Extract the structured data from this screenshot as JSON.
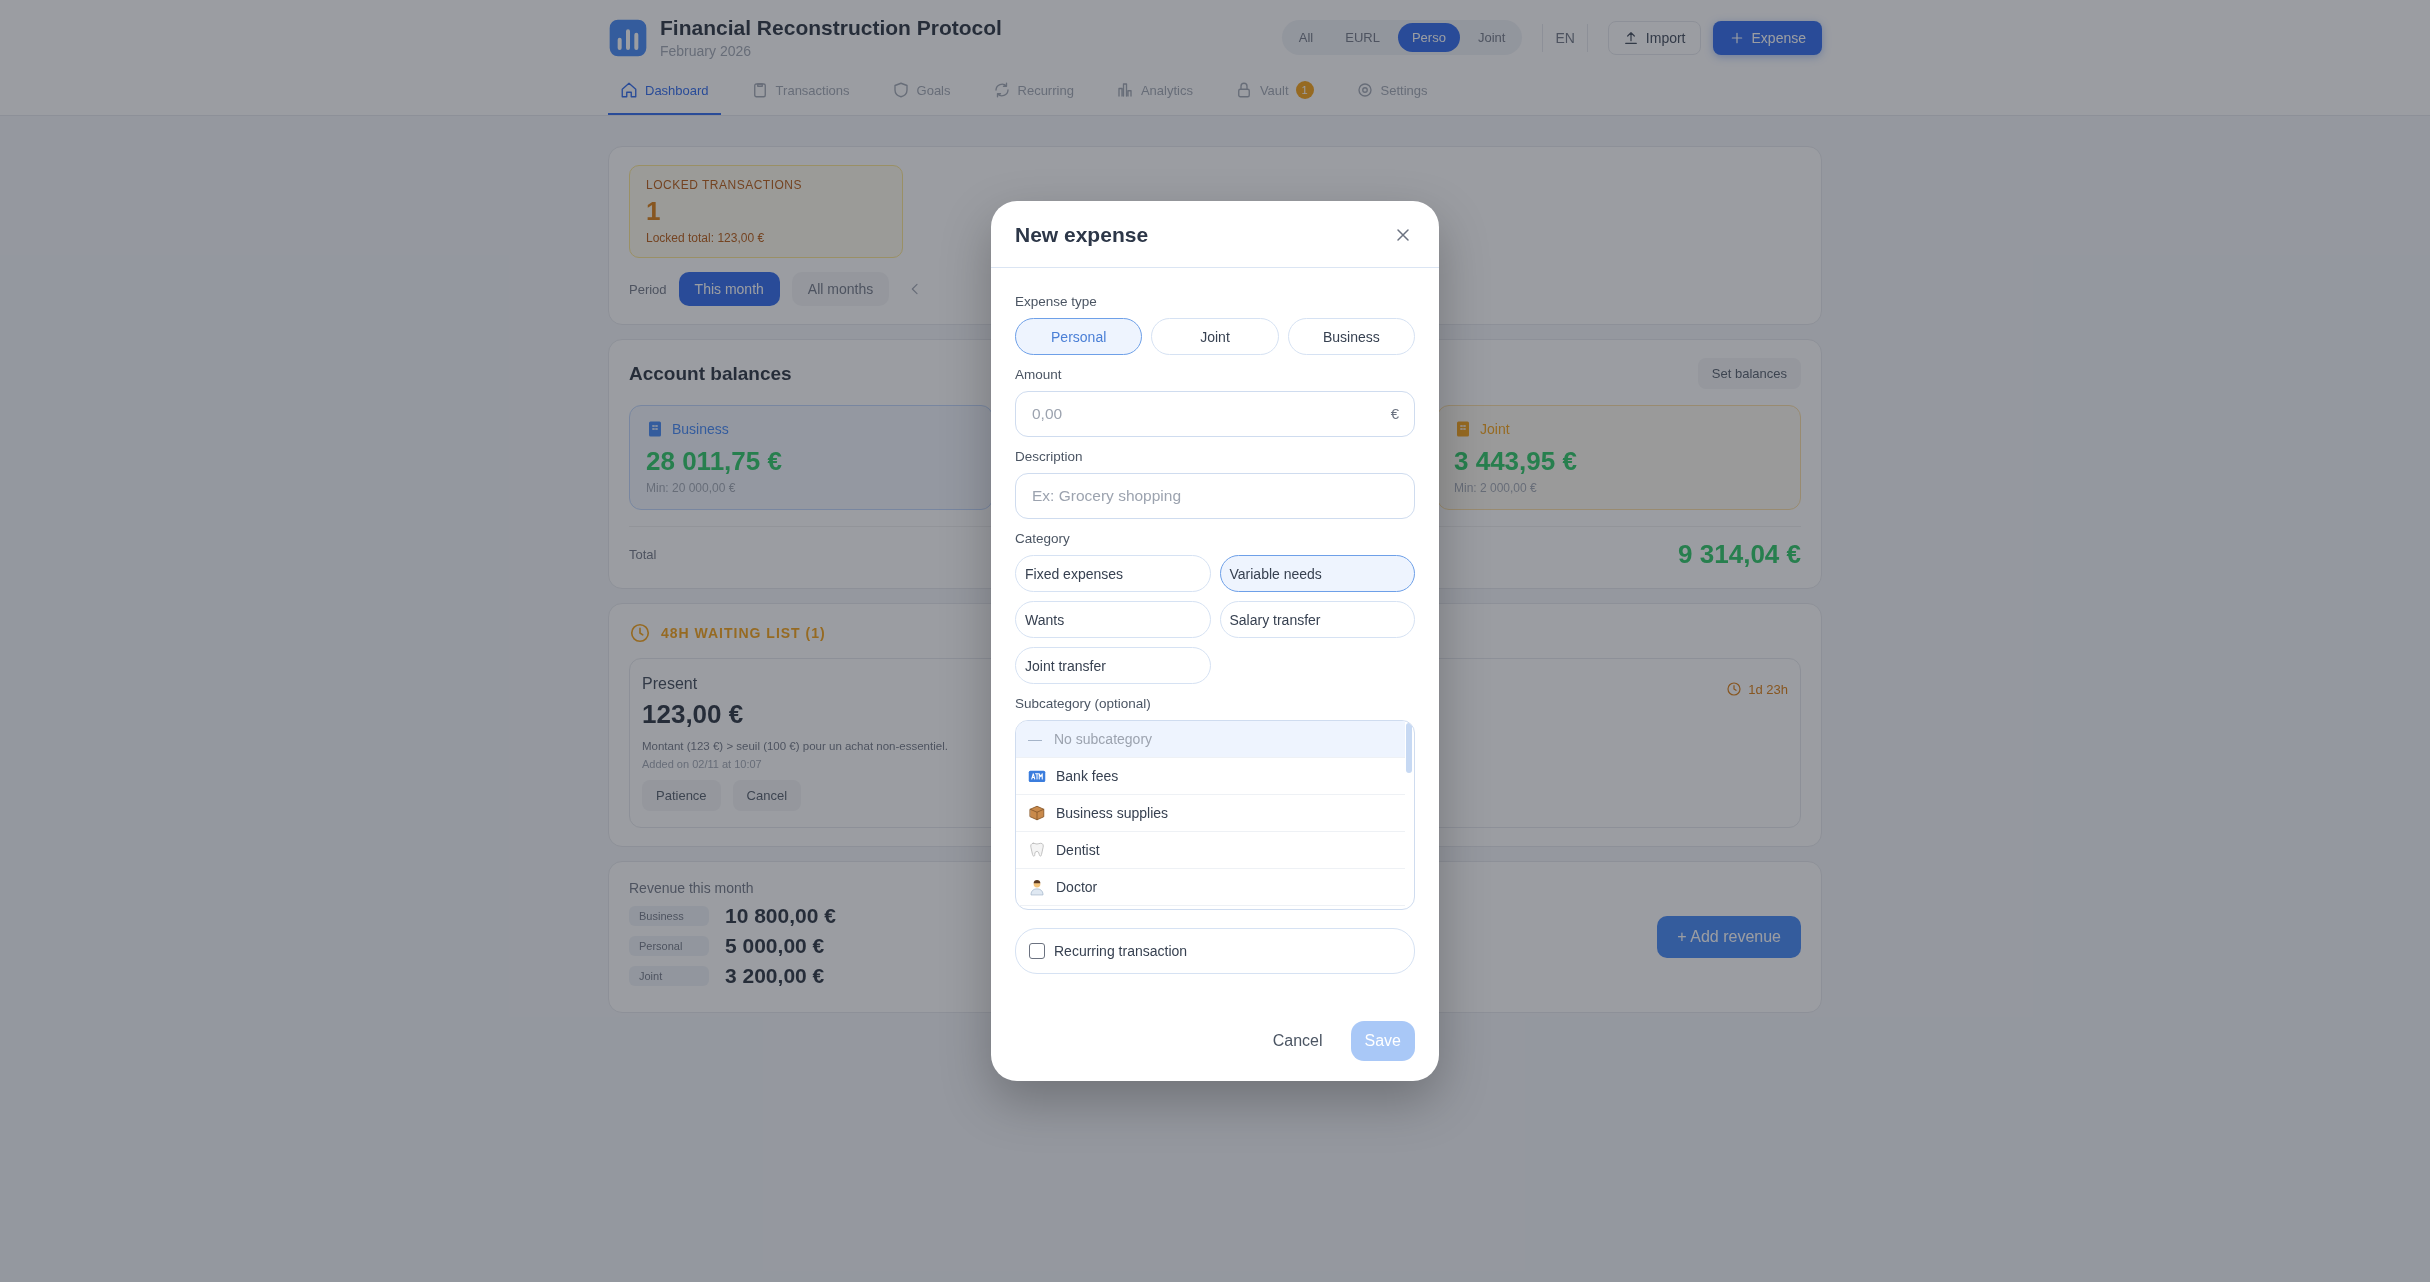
{
  "header": {
    "title": "Financial Reconstruction Protocol",
    "subtitle": "February 2026",
    "scopes": [
      {
        "label": "All",
        "selected": false
      },
      {
        "label": "EURL",
        "selected": false
      },
      {
        "label": "Perso",
        "selected": true
      },
      {
        "label": "Joint",
        "selected": false
      }
    ],
    "language": "EN",
    "import_button": "Import",
    "expense_button": "Expense"
  },
  "nav": [
    {
      "label": "Dashboard",
      "selected": true
    },
    {
      "label": "Transactions",
      "selected": false
    },
    {
      "label": "Goals",
      "selected": false
    },
    {
      "label": "Recurring",
      "selected": false
    },
    {
      "label": "Analytics",
      "selected": false
    },
    {
      "label": "Vault",
      "selected": false,
      "badge": "1"
    },
    {
      "label": "Settings",
      "selected": false
    }
  ],
  "locked": {
    "title": "LOCKED TRANSACTIONS",
    "count": "1",
    "total": "Locked total: 123,00 €"
  },
  "period": {
    "label": "Period",
    "options": [
      {
        "label": "This month",
        "selected": true
      },
      {
        "label": "All months",
        "selected": false
      }
    ]
  },
  "balances": {
    "title": "Account balances",
    "action": "Set balances",
    "accounts": [
      {
        "kind": "business",
        "name": "Business",
        "amount": "28 011,75 €",
        "minimum": "Min: 20 000,00 €"
      },
      {
        "kind": "joint",
        "name": "Joint",
        "amount": "3 443,95 €",
        "minimum": "Min: 2 000,00 €"
      }
    ],
    "total_label": "Total",
    "total": "9 314,04 €"
  },
  "waiting": {
    "title": "48H WAITING LIST (1)",
    "item": {
      "name": "Present",
      "amount": "123,00 €",
      "reason": "Montant (123 €) > seuil (100 €) pour un achat non-essentiel.",
      "added": "Added on 02/11 at 10:07",
      "timer": "1d 23h"
    },
    "actions": [
      "Patience",
      "Cancel"
    ]
  },
  "revenue": {
    "title": "Revenue this month",
    "rows": [
      {
        "label": "Business",
        "amount": "10 800,00 €"
      },
      {
        "label": "Personal",
        "amount": "5 000,00 €"
      },
      {
        "label": "Joint",
        "amount": "3 200,00 €"
      }
    ],
    "add_button": "+ Add revenue"
  },
  "modal": {
    "title": "New expense",
    "type_label": "Expense type",
    "types": [
      {
        "label": "Personal",
        "selected": true
      },
      {
        "label": "Joint",
        "selected": false
      },
      {
        "label": "Business",
        "selected": false
      }
    ],
    "amount": {
      "label": "Amount",
      "placeholder": "0,00",
      "currency": "€"
    },
    "description": {
      "label": "Description",
      "placeholder": "Ex: Grocery shopping"
    },
    "category_label": "Category",
    "categories": [
      {
        "label": "Fixed expenses",
        "selected": false
      },
      {
        "label": "Variable needs",
        "selected": true
      },
      {
        "label": "Wants",
        "selected": false
      },
      {
        "label": "Salary transfer",
        "selected": false
      },
      {
        "label": "Joint transfer",
        "selected": false
      }
    ],
    "subcategory_label": "Subcategory (optional)",
    "subcategories": [
      {
        "kind": "none",
        "marker": "—",
        "label": "No subcategory",
        "selected": true
      },
      {
        "kind": "atm",
        "label": "Bank fees",
        "selected": false
      },
      {
        "kind": "box",
        "label": "Business supplies",
        "selected": false
      },
      {
        "kind": "tooth",
        "label": "Dentist",
        "selected": false
      },
      {
        "kind": "person",
        "label": "Doctor",
        "selected": false
      }
    ],
    "recurring": {
      "label": "Recurring transaction",
      "checked": false
    },
    "cancel": "Cancel",
    "save": "Save",
    "save_enabled": false
  }
}
